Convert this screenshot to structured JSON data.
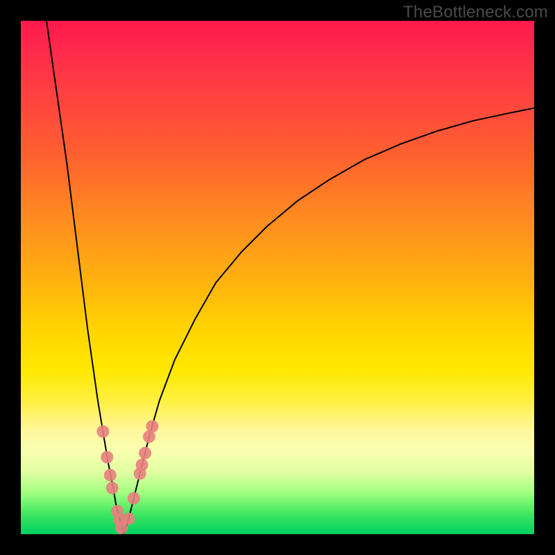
{
  "watermark": "TheBottleneck.com",
  "chart_data": {
    "type": "line",
    "title": "",
    "xlabel": "",
    "ylabel": "",
    "xlim": [
      0,
      100
    ],
    "ylim": [
      0,
      100
    ],
    "grid": false,
    "legend": false,
    "series": [
      {
        "name": "left-curve",
        "x": [
          5,
          6,
          7,
          8,
          9,
          10,
          11,
          12,
          13,
          14,
          15,
          16,
          17,
          18,
          18.5,
          19,
          19.5,
          20
        ],
        "y": [
          100,
          93,
          86,
          79,
          72,
          64,
          56,
          48,
          40,
          33,
          26,
          20,
          14,
          9,
          6,
          4,
          2,
          0
        ]
      },
      {
        "name": "right-curve",
        "x": [
          20,
          21,
          22,
          23,
          24,
          25,
          27,
          30,
          34,
          38,
          43,
          48,
          54,
          60,
          67,
          74,
          81,
          88,
          95,
          100
        ],
        "y": [
          0,
          3,
          7,
          11,
          15,
          19,
          26,
          34,
          42,
          49,
          55,
          60,
          65,
          69,
          73,
          76,
          78.5,
          80.5,
          82,
          83
        ]
      }
    ],
    "markers_left": {
      "name": "left-markers",
      "x": [
        16.0,
        16.8,
        17.4,
        17.8,
        18.8,
        19.2,
        19.6
      ],
      "y": [
        20.0,
        15.0,
        11.5,
        9.0,
        4.5,
        2.8,
        1.2
      ]
    },
    "markers_right": {
      "name": "right-markers",
      "x": [
        21.0,
        22.0,
        23.2,
        23.6,
        24.2,
        25.0,
        25.6
      ],
      "y": [
        3.0,
        7.0,
        11.8,
        13.5,
        15.8,
        19.0,
        21.0
      ]
    },
    "annotations": []
  }
}
